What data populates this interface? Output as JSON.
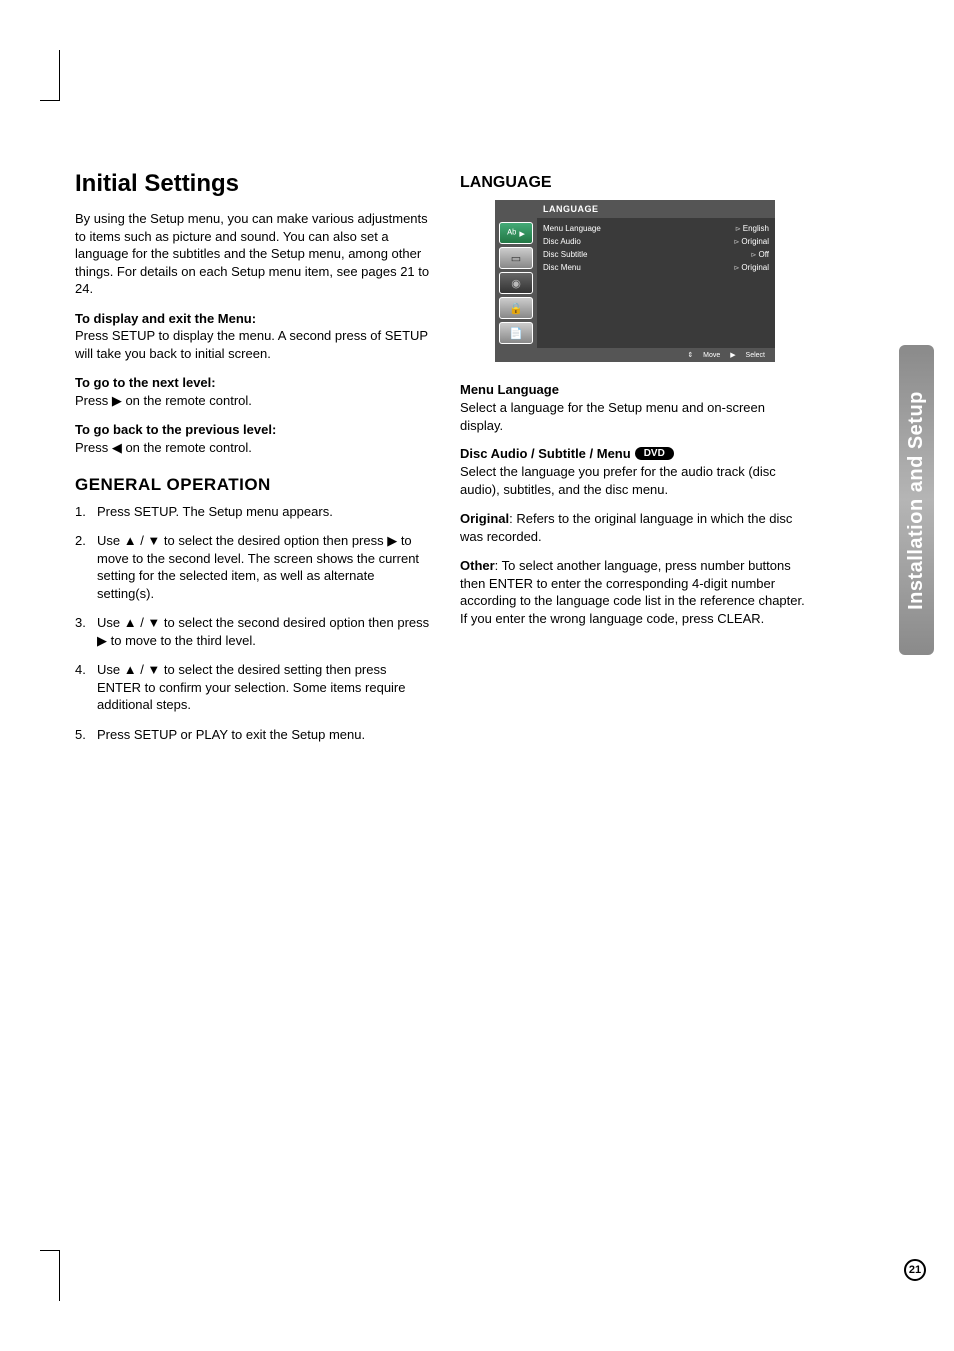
{
  "sideTab": "Installation and Setup",
  "pageNumber": "21",
  "left": {
    "title": "Initial Settings",
    "intro": "By using the Setup menu, you can make various adjustments to items such as picture and sound. You can also set a language for the subtitles and the Setup menu, among other things. For details on each Setup menu item, see pages 21 to 24.",
    "displayExit": {
      "head": "To display and exit the Menu:",
      "body": "Press SETUP to display the menu. A second press of SETUP will take you back to initial screen."
    },
    "nextLevel": {
      "head": "To go to the next level:",
      "body": "Press ▶ on the remote control."
    },
    "prevLevel": {
      "head": "To go back to the previous level:",
      "body": "Press ◀ on the remote control."
    },
    "generalOp": "GENERAL OPERATION",
    "steps": [
      "Press SETUP. The Setup menu appears.",
      "Use ▲ / ▼ to select the desired option then press ▶ to move to the second level. The screen shows the current setting for the selected item, as well as alternate setting(s).",
      "Use ▲ / ▼ to select the second desired option then press ▶ to move to the third level.",
      "Use ▲ / ▼ to select the desired setting then press ENTER to confirm your selection. Some items require additional steps.",
      "Press SETUP or PLAY to exit the Setup menu."
    ]
  },
  "right": {
    "title": "LANGUAGE",
    "menuShot": {
      "title": "LANGUAGE",
      "rows": [
        {
          "label": "Menu Language",
          "value": "English"
        },
        {
          "label": "Disc Audio",
          "value": "Original"
        },
        {
          "label": "Disc Subtitle",
          "value": "Off"
        },
        {
          "label": "Disc Menu",
          "value": "Original"
        }
      ],
      "footer": {
        "move": "Move",
        "select": "Select"
      }
    },
    "menuLang": {
      "head": "Menu Language",
      "body": "Select a language for the Setup menu and on-screen display."
    },
    "discAudio": {
      "head": "Disc Audio / Subtitle / Menu",
      "badge": "DVD",
      "body": "Select the language you prefer for the audio track (disc audio), subtitles, and the disc menu."
    },
    "original": {
      "bold": "Original",
      "rest": ": Refers to the original language in which the disc was recorded."
    },
    "other": {
      "bold": "Other",
      "rest": ": To select another language, press number buttons then ENTER to enter the corresponding 4-digit number according to the language code list in the reference chapter. If you enter the wrong language code, press CLEAR."
    }
  }
}
